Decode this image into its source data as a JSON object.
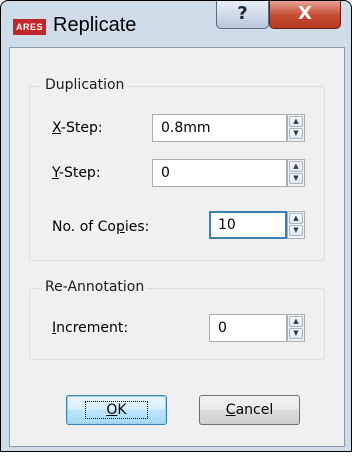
{
  "window": {
    "icon_text": "ARES",
    "title": "Replicate",
    "help_glyph": "?",
    "close_glyph": "X"
  },
  "duplication": {
    "group_label": "Duplication",
    "x_step": {
      "label_mnemonic": "X",
      "label_rest": "-Step:",
      "value": "0.8mm"
    },
    "y_step": {
      "label_mnemonic": "Y",
      "label_rest": "-Step:",
      "value": "0"
    },
    "copies": {
      "label_before": "No. of Co",
      "label_mnemonic": "p",
      "label_after": "ies:",
      "value": "10"
    }
  },
  "reannotation": {
    "group_label": "Re-Annotation",
    "increment": {
      "label_mnemonic": "I",
      "label_rest": "ncrement:",
      "value": "0"
    }
  },
  "buttons": {
    "ok": {
      "mnemonic": "O",
      "rest": "K"
    },
    "cancel": {
      "mnemonic": "C",
      "rest": "ancel"
    }
  },
  "icons": {
    "spin_up": "▲",
    "spin_down": "▼"
  }
}
